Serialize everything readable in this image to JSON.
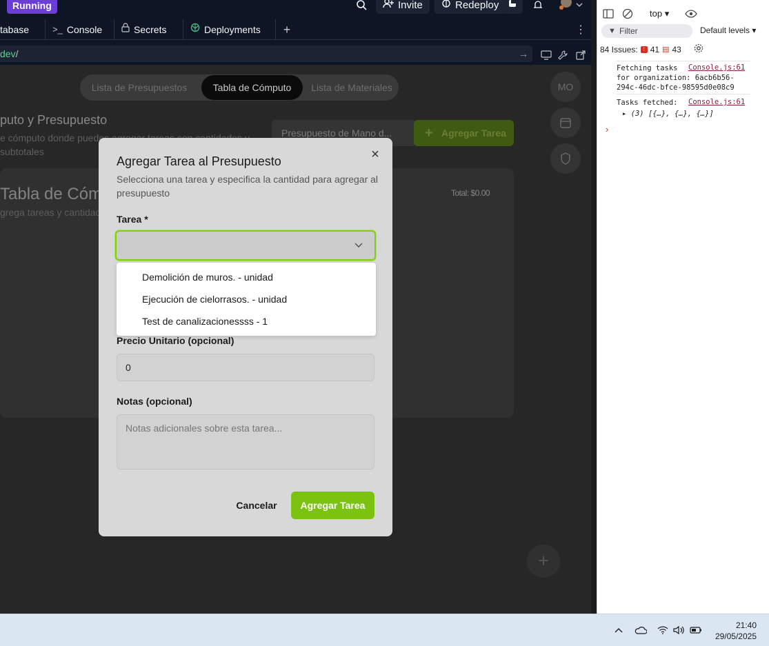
{
  "topbar": {
    "status": "Running",
    "invite_label": "Invite",
    "redeploy_label": "Redeploy"
  },
  "tabs": [
    {
      "label": "tabase",
      "icon": "database-icon"
    },
    {
      "label": "Console",
      "icon": "terminal-icon"
    },
    {
      "label": "Secrets",
      "icon": "lock-icon"
    },
    {
      "label": "Deployments",
      "icon": "deploy-icon"
    }
  ],
  "url": {
    "host_tail": "dev",
    "path": "/"
  },
  "preview": {
    "tabs": [
      "Lista de Presupuestos",
      "Tabla de Cómputo",
      "Lista de Materiales"
    ],
    "active_tab_index": 1,
    "avatar_initials": "MO",
    "title": "puto y Presupuesto",
    "subtitle": "e cómputo donde puedes agregar tareas con cantidades y subtotales",
    "select_value": "Presupuesto de Mano d...",
    "add_button": "Agregar Tarea",
    "card_title": "Tabla de Cómp",
    "card_subtitle": "grega tareas y cantidad",
    "total": "Total: $0.00"
  },
  "modal": {
    "title": "Agregar Tarea al Presupuesto",
    "description": "Selecciona una tarea y especifica la cantidad para agregar al presupuesto",
    "task_label": "Tarea *",
    "options": [
      "Demolición de muros. - unidad",
      "Ejecución de cielorrasos. - unidad",
      "Test de canalizacionessss - 1"
    ],
    "price_label": "Precio Unitario (opcional)",
    "price_value": "0",
    "notes_label": "Notas (opcional)",
    "notes_placeholder": "Notas adicionales sobre esta tarea...",
    "cancel": "Cancelar",
    "submit": "Agregar Tarea",
    "accent_color": "#84cc16"
  },
  "devtools": {
    "context": "top",
    "filter_placeholder": "Filter",
    "levels": "Default levels",
    "issues_label": "84 Issues:",
    "issues_errors": "41",
    "issues_messages": "43",
    "logs": [
      {
        "text": "Fetching tasks\nfor organization: 6acb6b56-\n294c-46dc-bfce-98595d0e08c9",
        "source": "Console.js:61"
      },
      {
        "text": "Tasks fetched:",
        "source": "Console.js:61",
        "detail": "(3) [{…}, {…}, {…}]"
      }
    ]
  },
  "taskbar": {
    "time": "21:40",
    "date": "29/05/2025"
  }
}
